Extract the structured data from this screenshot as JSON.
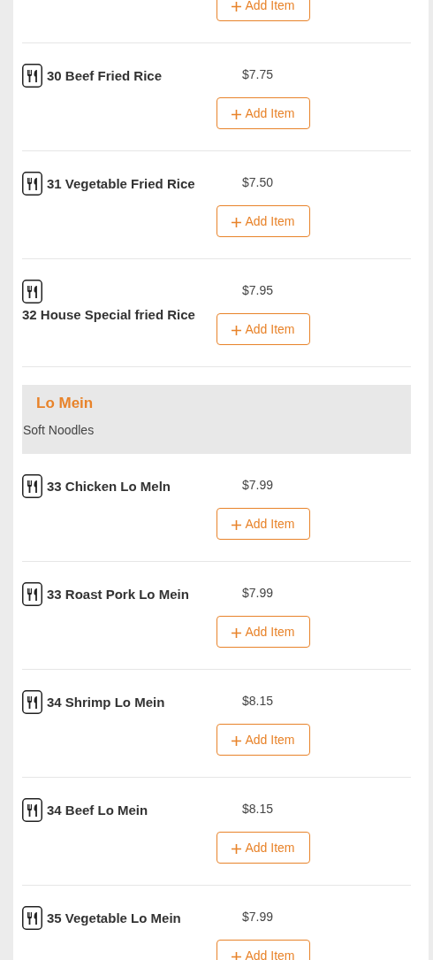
{
  "sections": [
    {
      "items": [
        {
          "kind": "partial",
          "button": "Add Item"
        },
        {
          "kind": "dish",
          "name": "30 Beef Fried Rice",
          "price": "$7.75",
          "button": "Add Item"
        },
        {
          "kind": "dish",
          "name": "31 Vegetable Fried Rice",
          "price": "$7.50",
          "button": "Add Item"
        },
        {
          "kind": "dish",
          "name": "32 House Special fried Rice",
          "price": "$7.95",
          "button": "Add Item"
        }
      ]
    },
    {
      "title": "Lo Mein",
      "description": "Soft Noodles",
      "items": [
        {
          "kind": "dish",
          "name": "33 Chicken Lo Meln",
          "price": "$7.99",
          "button": "Add Item"
        },
        {
          "kind": "dish",
          "name": "33 Roast Pork Lo Mein",
          "price": "$7.99",
          "button": "Add Item"
        },
        {
          "kind": "dish",
          "name": "34 Shrimp Lo Mein",
          "price": "$8.15",
          "button": "Add Item"
        },
        {
          "kind": "dish",
          "name": "34 Beef Lo Mein",
          "price": "$8.15",
          "button": "Add Item"
        },
        {
          "kind": "dish",
          "name": "35 Vegetable Lo Mein",
          "price": "$7.99",
          "button": "Add Item"
        }
      ]
    }
  ]
}
